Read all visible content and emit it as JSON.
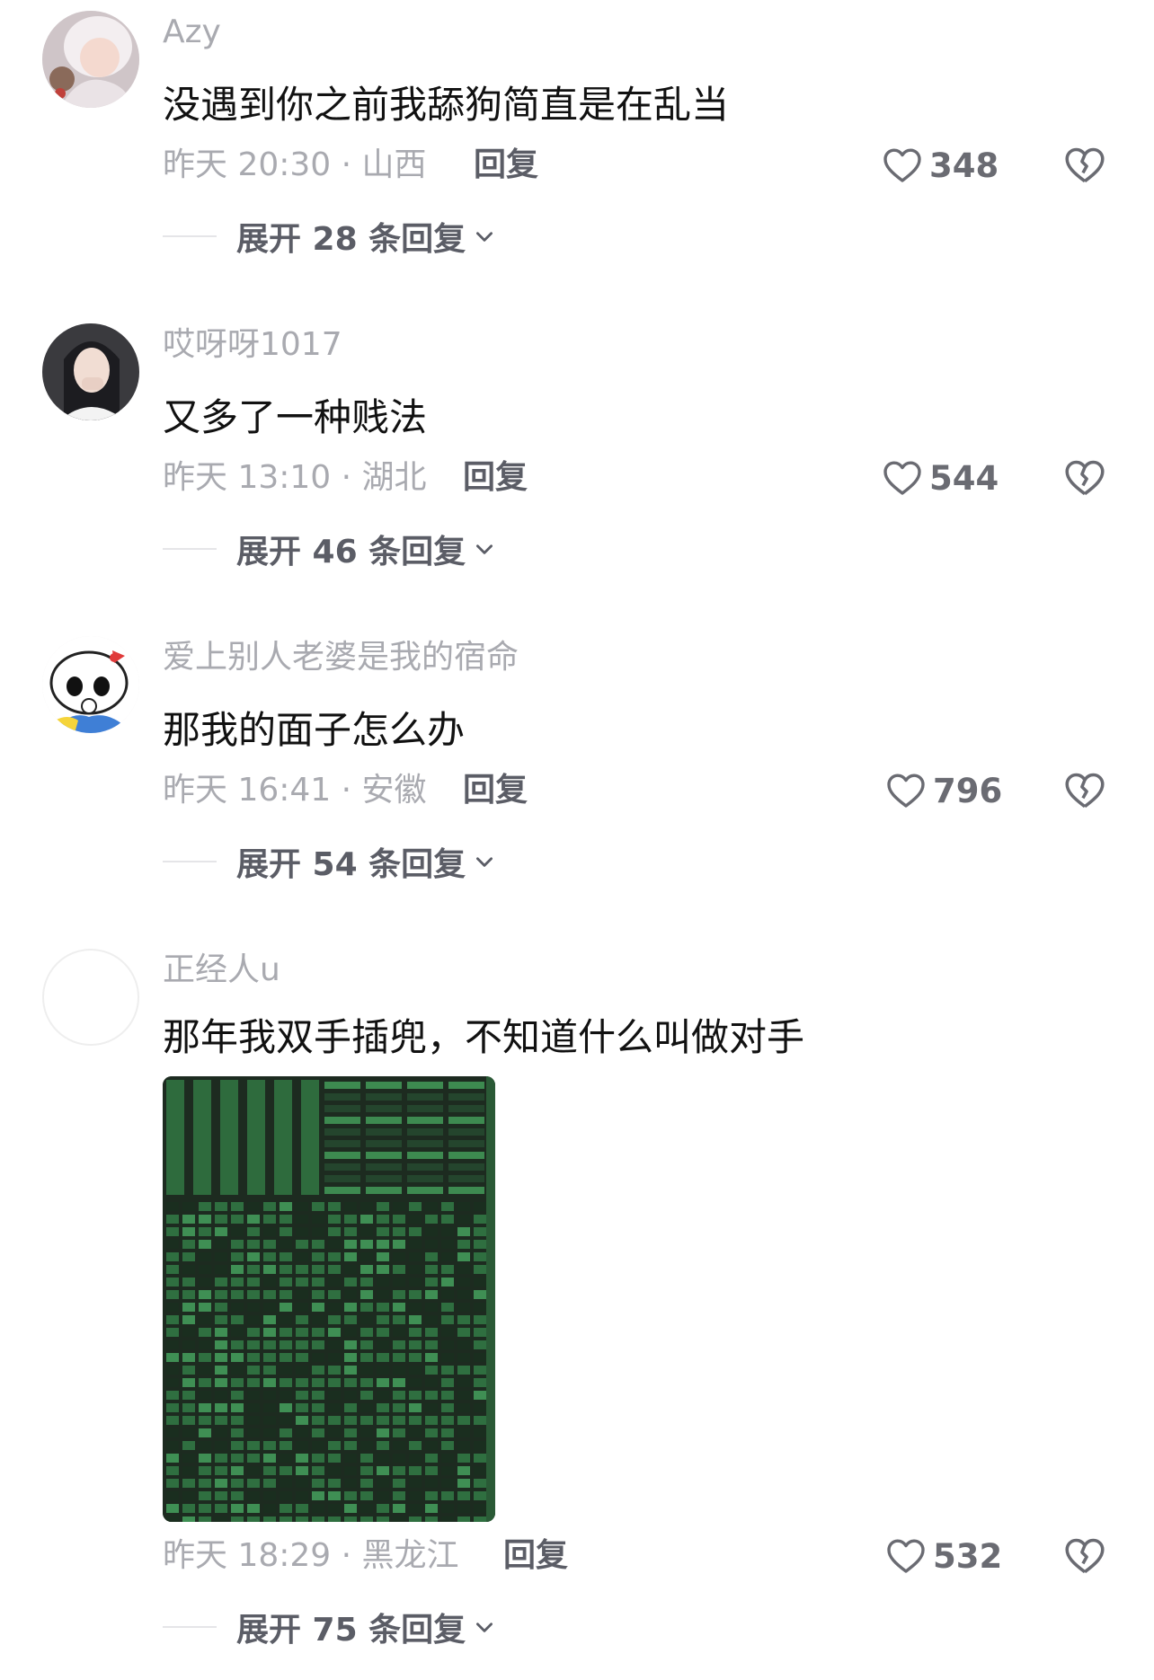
{
  "comments": [
    {
      "username": "Azy",
      "text": "没遇到你之前我舔狗简直是在乱当",
      "meta": "昨天 20:30 · 山西",
      "reply_label": "回复",
      "likes": "348",
      "expand_label": "展开 28 条回复"
    },
    {
      "username": "哎呀呀1017",
      "text": "又多了一种贱法",
      "meta": "昨天 13:10 · 湖北",
      "reply_label": "回复",
      "likes": "544",
      "expand_label": "展开 46 条回复"
    },
    {
      "username": "爱上别人老婆是我的宿命",
      "text": "那我的面子怎么办",
      "meta": "昨天 16:41 · 安徽",
      "reply_label": "回复",
      "likes": "796",
      "expand_label": "展开 54 条回复"
    },
    {
      "username": "正经人u",
      "text": "那年我双手插兜，不知道什么叫做对手",
      "meta": "昨天 18:29 · 黑龙江",
      "reply_label": "回复",
      "likes": "532",
      "expand_label": "展开 75 条回复"
    }
  ],
  "icons": {
    "like": "heart-outline-icon",
    "dislike": "broken-heart-icon",
    "expand": "chevron-down-icon"
  },
  "colors": {
    "username": "#a9aab0",
    "body_text": "#111111",
    "secondary": "#5b5d66",
    "image_green": "#2e6b3d"
  }
}
